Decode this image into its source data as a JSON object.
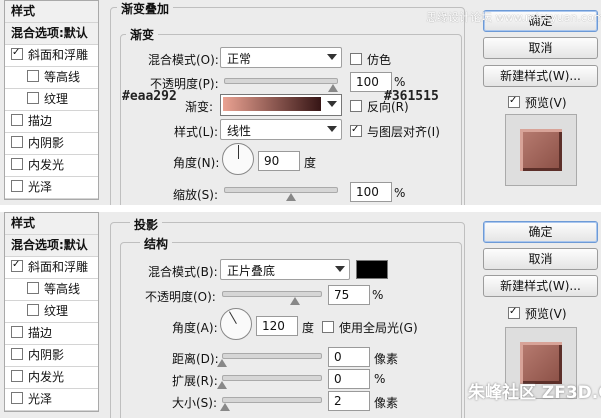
{
  "top": {
    "sidebar": [
      {
        "label": "样式",
        "type": "header"
      },
      {
        "label": "混合选项:默认",
        "type": "header"
      },
      {
        "label": "斜面和浮雕",
        "checked": true
      },
      {
        "label": "等高线",
        "checked": false,
        "sub": true
      },
      {
        "label": "纹理",
        "checked": false,
        "sub": true
      },
      {
        "label": "描边",
        "checked": false
      },
      {
        "label": "内阴影",
        "checked": false
      },
      {
        "label": "内发光",
        "checked": false
      },
      {
        "label": "光泽",
        "checked": false
      }
    ],
    "section_title": "渐变叠加",
    "group_title": "渐变",
    "blend_label": "混合模式(O):",
    "blend_value": "正常",
    "dither_label": "仿色",
    "opacity_label": "不透明度(P):",
    "opacity_value": "100",
    "pct": "%",
    "gradient_label": "渐变:",
    "reverse_label": "反向(R)",
    "color_left": "#eaa292",
    "color_right": "#361515",
    "style_label": "样式(L):",
    "style_value": "线性",
    "align_label": "与图层对齐(I)",
    "angle_label": "角度(N):",
    "angle_value": "90",
    "deg": "度",
    "scale_label": "缩放(S):",
    "scale_value": "100",
    "buttons": {
      "ok": "确定",
      "cancel": "取消",
      "new_style": "新建样式(W)...",
      "preview": "预览(V)"
    },
    "watermark": "思缘设计论坛 www.missyuan.com"
  },
  "bottom": {
    "sidebar": [
      {
        "label": "样式",
        "type": "header"
      },
      {
        "label": "混合选项:默认",
        "type": "header"
      },
      {
        "label": "斜面和浮雕",
        "checked": true
      },
      {
        "label": "等高线",
        "checked": false,
        "sub": true
      },
      {
        "label": "纹理",
        "checked": false,
        "sub": true
      },
      {
        "label": "描边",
        "checked": false
      },
      {
        "label": "内阴影",
        "checked": false
      },
      {
        "label": "内发光",
        "checked": false
      },
      {
        "label": "光泽",
        "checked": false
      }
    ],
    "section_title": "投影",
    "group_title": "结构",
    "blend_label": "混合模式(B):",
    "blend_value": "正片叠底",
    "opacity_label": "不透明度(O):",
    "opacity_value": "75",
    "pct": "%",
    "angle_label": "角度(A):",
    "angle_value": "120",
    "deg": "度",
    "global_light_label": "使用全局光(G)",
    "distance_label": "距离(D):",
    "distance_value": "0",
    "spread_label": "扩展(R):",
    "spread_value": "0",
    "size_label": "大小(S):",
    "size_value": "2",
    "px": "像素",
    "buttons": {
      "ok": "确定",
      "cancel": "取消",
      "new_style": "新建样式(W)...",
      "preview": "预览(V)"
    },
    "watermark": "朱峰社区 ZF3D.COM"
  }
}
